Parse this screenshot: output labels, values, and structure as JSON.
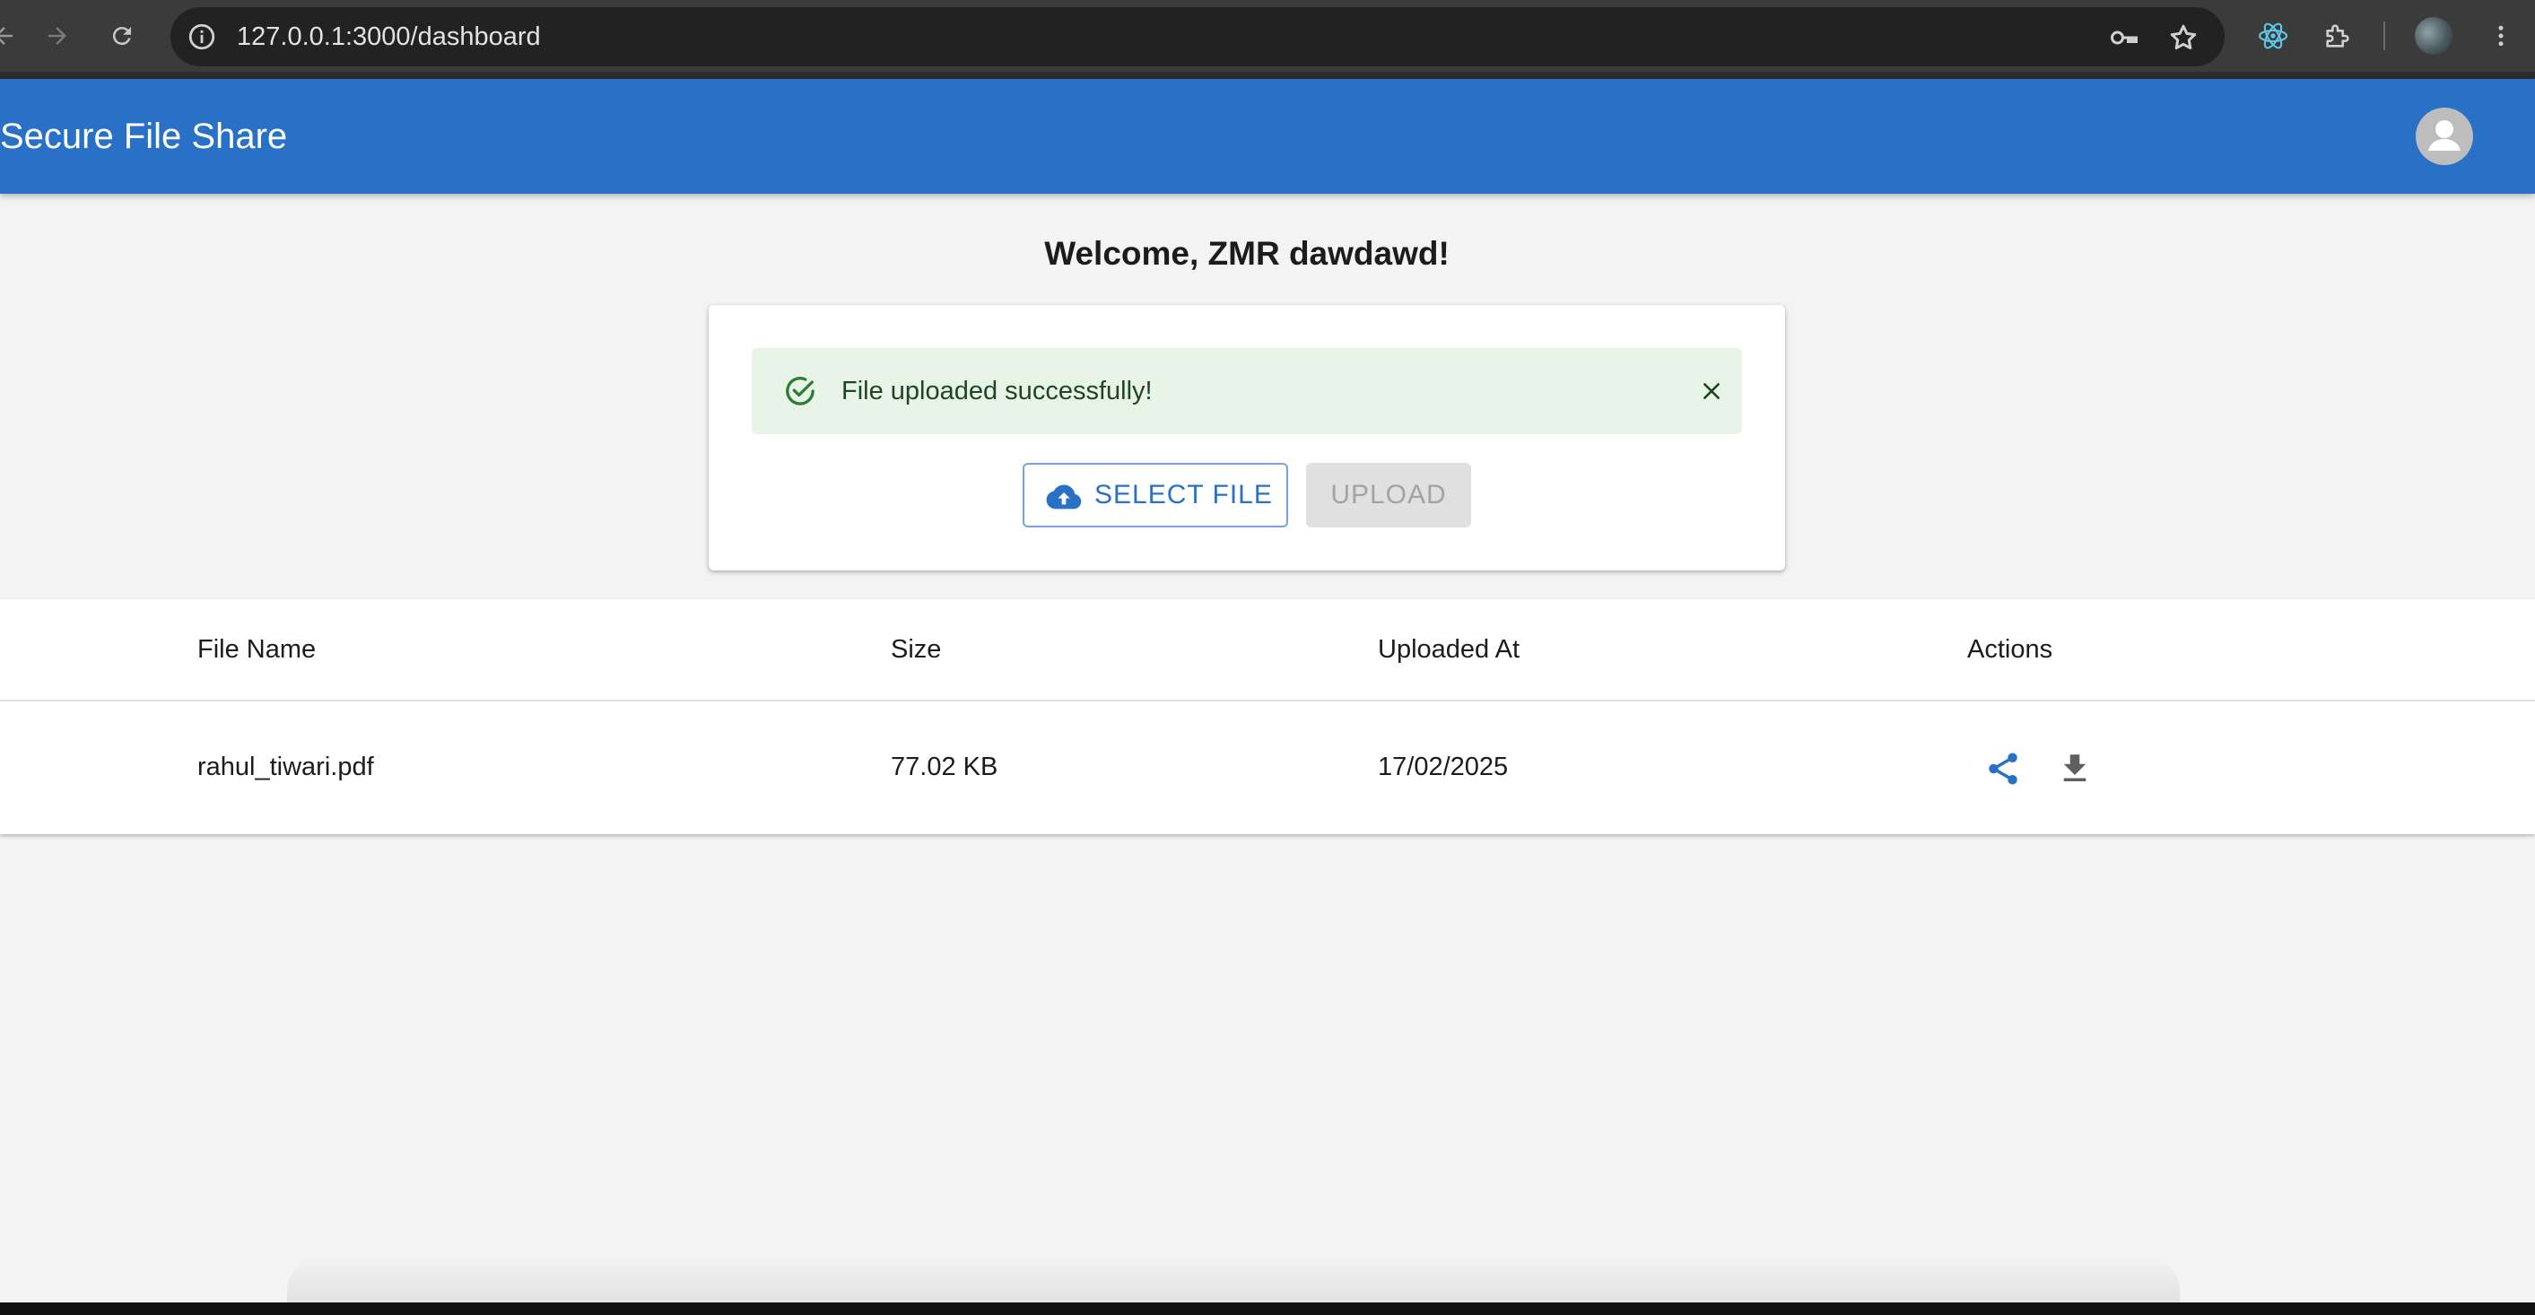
{
  "browser": {
    "url": "127.0.0.1:3000/dashboard",
    "icons": [
      "back-arrow-icon",
      "forward-arrow-icon",
      "reload-icon",
      "site-info-icon",
      "password-key-icon",
      "bookmark-star-icon",
      "react-devtools-icon",
      "extensions-puzzle-icon",
      "profile-avatar",
      "more-vert-icon"
    ]
  },
  "app_bar": {
    "title": "Secure File Share",
    "color": "#2971c6",
    "account_icon": "account-circle-icon"
  },
  "main": {
    "welcome": "Welcome, ZMR dawdawd!",
    "alert": {
      "severity": "success",
      "message": "File uploaded successfully!",
      "icon": "check-circle-outline-icon",
      "close_icon": "close-icon"
    },
    "select_button": {
      "label": "SELECT FILE",
      "icon": "cloud-upload-icon"
    },
    "upload_button": {
      "label": "UPLOAD",
      "disabled": true
    }
  },
  "table": {
    "columns": [
      "File Name",
      "Size",
      "Uploaded At",
      "Actions"
    ],
    "rows": [
      {
        "file_name": "rahul_tiwari.pdf",
        "size": "77.02 KB",
        "uploaded_at": "17/02/2025",
        "actions": [
          "share-icon",
          "download-icon"
        ]
      }
    ]
  }
}
